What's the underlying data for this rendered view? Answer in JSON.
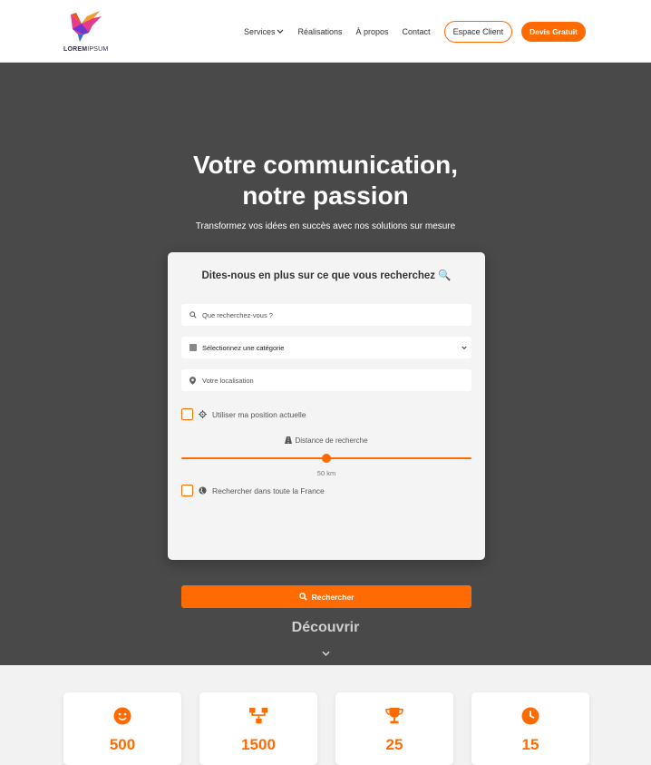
{
  "brand": {
    "logo_text_bold": "LOREM",
    "logo_text_light": "IPSUM",
    "accent": "#ff6b00"
  },
  "nav": {
    "items": [
      {
        "label": "Services",
        "icon": "chevron-down-icon"
      },
      {
        "label": "Réalisations"
      },
      {
        "label": "À propos"
      },
      {
        "label": "Contact"
      }
    ],
    "client_button": "Espace Client",
    "quote_button": "Devis Gratuit"
  },
  "hero": {
    "title_line1": "Votre communication,",
    "title_line2": "notre passion",
    "subtitle": "Transformez vos idées en succès avec nos solutions sur mesure",
    "background": "#494949"
  },
  "search_card": {
    "title": "Dites-nous en plus sur ce que vous recherchez 🔍",
    "query_placeholder": "Que recherchez-vous ?",
    "category_selected": "Sélectionnez une catégorie",
    "location_placeholder": "Votre localisation",
    "use_position_label": "Utiliser ma position actuelle",
    "distance_label": "Distance de recherche",
    "distance_value": "50 km",
    "distance_fraction": 0.5,
    "all_france_label": "Rechercher dans toute la France",
    "search_button": "Rechercher"
  },
  "discover": {
    "label": "Découvrir"
  },
  "stats": [
    {
      "icon": "smiley-icon",
      "value": "500"
    },
    {
      "icon": "sitemap-icon",
      "value": "1500"
    },
    {
      "icon": "trophy-icon",
      "value": "25"
    },
    {
      "icon": "clock-icon",
      "value": "15"
    }
  ]
}
